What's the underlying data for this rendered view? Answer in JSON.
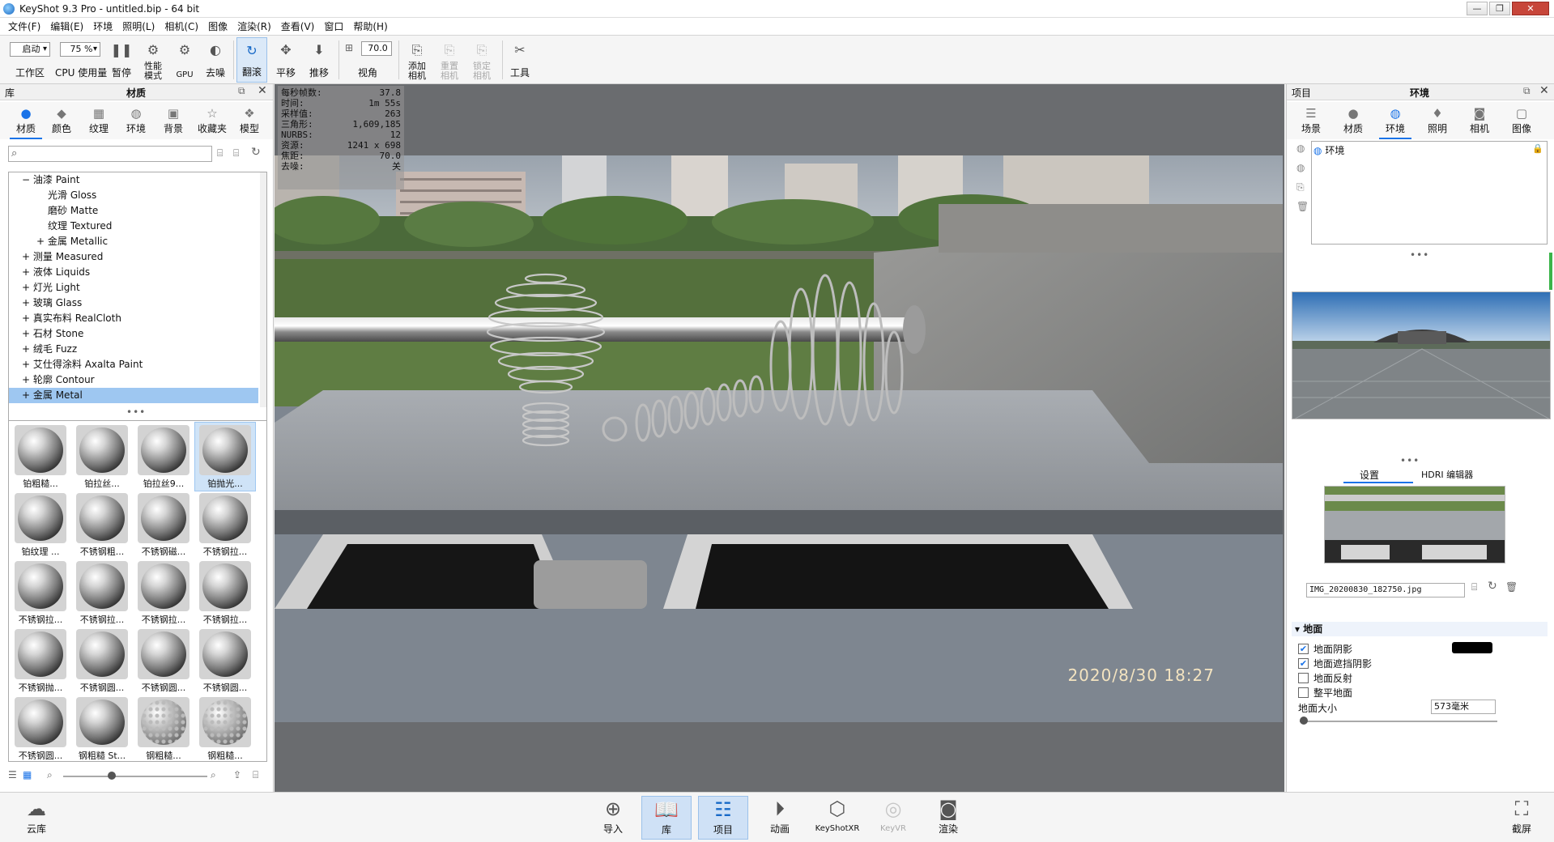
{
  "window": {
    "title": "KeyShot 9.3 Pro  - untitled.bip  - 64 bit",
    "min": "—",
    "max": "❐",
    "close": "✕"
  },
  "menu": [
    "文件(F)",
    "编辑(E)",
    "环境",
    "照明(L)",
    "相机(C)",
    "图像",
    "渲染(R)",
    "查看(V)",
    "窗口",
    "帮助(H)"
  ],
  "toolbar": {
    "workspace_value": "启动",
    "workspace_label": "工作区",
    "cpu_value": "75 %",
    "cpu_label": "CPU 使用量",
    "pause_label": "暂停",
    "perf_label": "性能\n模式",
    "gpu_label": "GPU",
    "denoise_label": "去噪",
    "tumble_label": "翻滚",
    "pan_label": "平移",
    "dolly_label": "推移",
    "fov_value": "70.0",
    "fov_label": "视角",
    "add_camera_label": "添加\n相机",
    "reset_camera_label": "重置\n相机",
    "lock_camera_label": "锁定\n相机",
    "tools_label": "工具"
  },
  "library": {
    "header_left": "库",
    "header_title": "材质",
    "tabs": [
      "材质",
      "颜色",
      "纹理",
      "环境",
      "背景",
      "收藏夹",
      "模型"
    ],
    "search_placeholder": "",
    "tree": [
      {
        "label": "油漆 Paint",
        "level": 1,
        "toggle": "−"
      },
      {
        "label": "光滑 Gloss",
        "level": 2,
        "toggle": ""
      },
      {
        "label": "磨砂 Matte",
        "level": 2,
        "toggle": ""
      },
      {
        "label": "纹理 Textured",
        "level": 2,
        "toggle": ""
      },
      {
        "label": "金属 Metallic",
        "level": 2,
        "toggle": "+"
      },
      {
        "label": "测量 Measured",
        "level": 1,
        "toggle": "+"
      },
      {
        "label": "液体 Liquids",
        "level": 1,
        "toggle": "+"
      },
      {
        "label": "灯光 Light",
        "level": 1,
        "toggle": "+"
      },
      {
        "label": "玻璃 Glass",
        "level": 1,
        "toggle": "+"
      },
      {
        "label": "真实布料 RealCloth",
        "level": 1,
        "toggle": "+"
      },
      {
        "label": "石材 Stone",
        "level": 1,
        "toggle": "+"
      },
      {
        "label": "绒毛 Fuzz",
        "level": 1,
        "toggle": "+"
      },
      {
        "label": "艾仕得涂料 Axalta Paint",
        "level": 1,
        "toggle": "+"
      },
      {
        "label": "轮廓 Contour",
        "level": 1,
        "toggle": "+"
      },
      {
        "label": "金属 Metal",
        "level": 1,
        "toggle": "+",
        "selected": true
      }
    ],
    "thumbnails": [
      "铂粗糙...",
      "铂拉丝...",
      "铂拉丝9...",
      "铂抛光...",
      "铂纹理 ...",
      "不锈钢粗...",
      "不锈钢磁...",
      "不锈钢拉...",
      "不锈钢拉...",
      "不锈钢拉...",
      "不锈钢拉...",
      "不锈钢拉...",
      "不锈钢抛...",
      "不锈钢圆...",
      "不锈钢圆...",
      "不锈钢圆...",
      "不锈钢圆...",
      "钢粗糙 St...",
      "钢粗糙...",
      "钢粗糙..."
    ]
  },
  "viewport": {
    "stats": [
      {
        "k": "每秒帧数:",
        "v": "37.8"
      },
      {
        "k": "时间:",
        "v": "1m 55s"
      },
      {
        "k": "采样值:",
        "v": "263"
      },
      {
        "k": "三角形:",
        "v": "1,609,185"
      },
      {
        "k": "NURBS:",
        "v": "12"
      },
      {
        "k": "资源:",
        "v": "1241 x 698"
      },
      {
        "k": "焦距:",
        "v": "70.0"
      },
      {
        "k": "去噪:",
        "v": "关"
      }
    ],
    "datestamp": "2020/8/30  18:27"
  },
  "project": {
    "header_left": "项目",
    "header_title": "环境",
    "tabs": [
      "场景",
      "材质",
      "环境",
      "照明",
      "相机",
      "图像"
    ],
    "env_item": "环境",
    "subtabs": [
      "设置",
      "HDRI 编辑器"
    ],
    "background_file": "IMG_20200830_182750.jpg",
    "ground_header": "地面",
    "ground_options": [
      {
        "label": "地面阴影",
        "checked": true
      },
      {
        "label": "地面遮挡阴影",
        "checked": true
      },
      {
        "label": "地面反射",
        "checked": false
      },
      {
        "label": "整平地面",
        "checked": false
      }
    ],
    "ground_size_label": "地面大小",
    "ground_size_value": "573毫米"
  },
  "bottombar": {
    "cloud": "云库",
    "items": [
      "导入",
      "库",
      "项目",
      "动画",
      "KeyShotXR",
      "KeyVR",
      "渲染"
    ],
    "screenshot": "截屏"
  },
  "colors": {
    "accent": "#1a73e8",
    "selection": "#9ec7f1"
  }
}
